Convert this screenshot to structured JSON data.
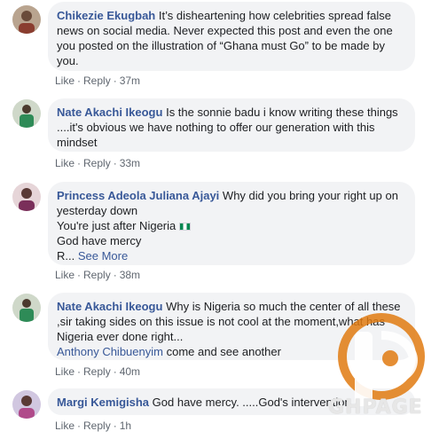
{
  "comments": [
    {
      "author": "Chikezie Ekugbah",
      "text": "It’s disheartening how celebrities spread false news on social media. Never expected this post and even the one you posted on the illustration of “Ghana must Go” to be made by you.",
      "like": "Like",
      "reply": "Reply",
      "time": "37m"
    },
    {
      "author": "Nate Akachi Ikeogu",
      "text": "Is the sonnie badu i know writing these things ....it's obvious we have nothing to offer our generation with this mindset",
      "like": "Like",
      "reply": "Reply",
      "time": "33m"
    },
    {
      "author": "Princess Adeola Juliana Ajayi",
      "text": "Why did you bring your right up on yesterday down",
      "line2": "You're just after Nigeria",
      "line3": "God have mercy",
      "line4": "R...",
      "see_more": "See More",
      "like": "Like",
      "reply": "Reply",
      "time": "38m"
    },
    {
      "author": "Nate Akachi Ikeogu",
      "text": "Why is Nigeria so much the center of all these ,sir taking sides on this issue is not cool at the moment,what has Nigeria ever done right...",
      "mention": "Anthony Chibuenyim",
      "mention_text": "come and see another",
      "like": "Like",
      "reply": "Reply",
      "time": "40m"
    },
    {
      "author": "Margi Kemigisha",
      "text": "God have mercy. .....God's intervention",
      "like": "Like",
      "reply": "Reply",
      "time": "1h"
    }
  ],
  "watermark": {
    "text": "GHPAGE",
    "color": "#e07a10"
  },
  "colors": {
    "link": "#385898",
    "bubble": "#f2f3f5",
    "meta": "#606770"
  },
  "icons": [
    "nigeria-flag-icon"
  ]
}
